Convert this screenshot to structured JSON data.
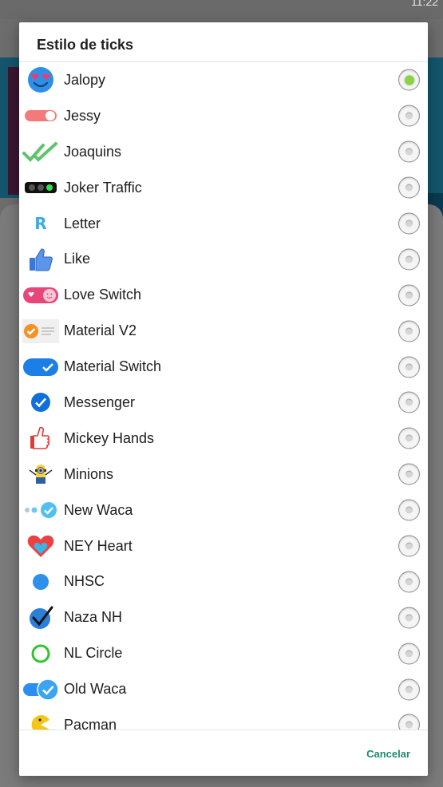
{
  "status_bar": {
    "time": "11:22"
  },
  "dialog": {
    "title": "Estilo de ticks",
    "cancel_label": "Cancelar",
    "options": [
      {
        "label": "Jalopy",
        "icon": "smiley-heart-eyes-icon",
        "selected": true
      },
      {
        "label": "Jessy",
        "icon": "red-toggle-icon",
        "selected": false
      },
      {
        "label": "Joaquins",
        "icon": "green-double-check-icon",
        "selected": false
      },
      {
        "label": "Joker Traffic",
        "icon": "traffic-light-icon",
        "selected": false
      },
      {
        "label": "Letter",
        "icon": "letter-r-icon",
        "selected": false
      },
      {
        "label": "Like",
        "icon": "thumbs-up-icon",
        "selected": false
      },
      {
        "label": "Love Switch",
        "icon": "love-switch-icon",
        "selected": false
      },
      {
        "label": "Material V2",
        "icon": "orange-check-lines-icon",
        "selected": false
      },
      {
        "label": "Material Switch",
        "icon": "blue-switch-check-icon",
        "selected": false
      },
      {
        "label": "Messenger",
        "icon": "blue-circle-check-icon",
        "selected": false
      },
      {
        "label": "Mickey Hands",
        "icon": "glove-thumb-icon",
        "selected": false
      },
      {
        "label": "Minions",
        "icon": "minion-icon",
        "selected": false
      },
      {
        "label": "New Waca",
        "icon": "dots-check-icon",
        "selected": false
      },
      {
        "label": "NEY Heart",
        "icon": "heart-icon",
        "selected": false
      },
      {
        "label": "NHSC",
        "icon": "blue-dot-icon",
        "selected": false
      },
      {
        "label": "Naza NH",
        "icon": "black-check-circle-icon",
        "selected": false
      },
      {
        "label": "NL Circle",
        "icon": "green-ring-icon",
        "selected": false
      },
      {
        "label": "Old Waca",
        "icon": "switch-check-bubble-icon",
        "selected": false
      },
      {
        "label": "Pacman",
        "icon": "pacman-icon",
        "selected": false
      }
    ]
  }
}
